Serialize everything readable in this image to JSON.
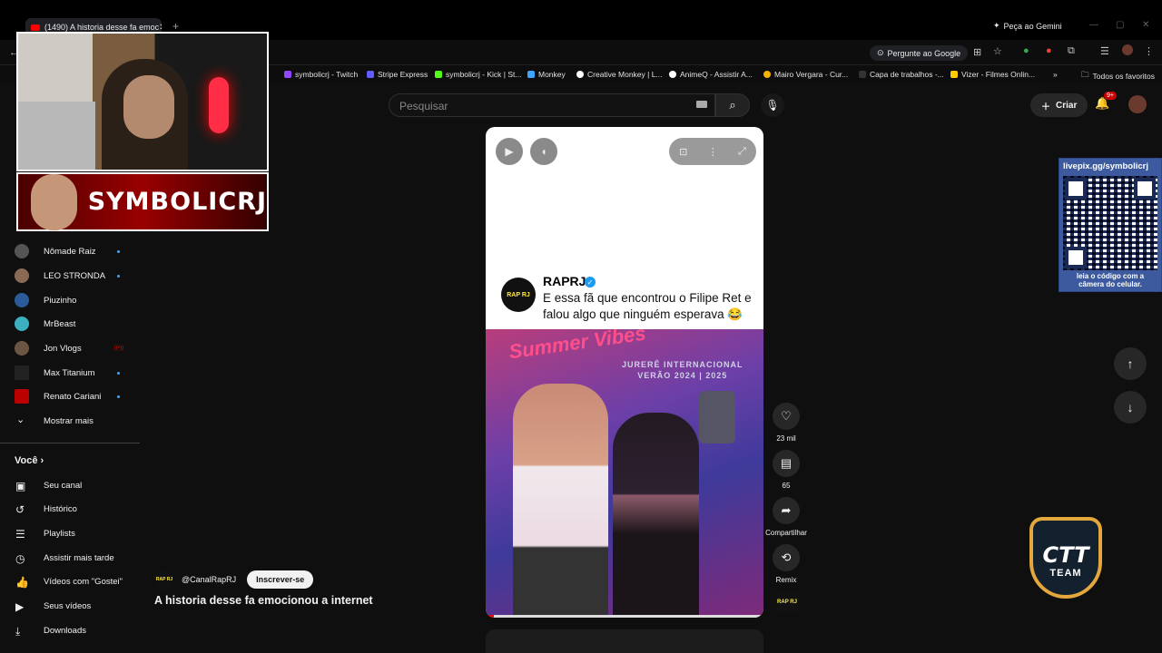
{
  "browser": {
    "tab_title": "(1490) A historia desse fa emoc",
    "new_tab": "+",
    "gemini": "Peça ao Gemini",
    "ask_google": "Pergunte ao Google"
  },
  "bookmarks": [
    {
      "label": "symbolicrj - Twitch",
      "color": "#9146ff"
    },
    {
      "label": "Stripe Express",
      "color": "#635bff"
    },
    {
      "label": "symbolicrj - Kick | St...",
      "color": "#53fc18"
    },
    {
      "label": "Monkey",
      "color": "#3ea6ff"
    },
    {
      "label": "Creative Monkey | L...",
      "color": "#ffffff"
    },
    {
      "label": "AnimeQ - Assistir A...",
      "color": "#ffffff"
    },
    {
      "label": "Mairo Vergara - Cur...",
      "color": "#f4b400"
    },
    {
      "label": "Capa de trabalhos -...",
      "color": "#333333"
    },
    {
      "label": "Vizer - Filmes Onlin...",
      "color": "#ffcc00"
    }
  ],
  "bookmarks_all": "Todos os favoritos",
  "masthead": {
    "search_placeholder": "Pesquisar",
    "create_label": "Criar",
    "notif_badge": "9+"
  },
  "overlay": {
    "streamer_name": "SYMBOLICRJ"
  },
  "sidebar": {
    "subscriptions": [
      {
        "name": "Nômade Raiz",
        "dot": true,
        "color": "#555"
      },
      {
        "name": "LEO STRONDA",
        "dot": true,
        "color": "#8a6a55"
      },
      {
        "name": "Piuzinho",
        "dot": false,
        "color": "#2a5a9a"
      },
      {
        "name": "MrBeast",
        "dot": false,
        "color": "#3ab0c0"
      },
      {
        "name": "Jon Vlogs",
        "dot": false,
        "live": true,
        "color": "#6b5545"
      },
      {
        "name": "Max Titanium",
        "dot": true,
        "color": "#222"
      },
      {
        "name": "Renato Cariani",
        "dot": true,
        "color": "#b00"
      }
    ],
    "show_more": "Mostrar mais",
    "you_label": "Você",
    "you_items": [
      {
        "label": "Seu canal",
        "icon": "channel-icon",
        "glyph": "▣"
      },
      {
        "label": "Histórico",
        "icon": "history-icon",
        "glyph": "↺"
      },
      {
        "label": "Playlists",
        "icon": "playlists-icon",
        "glyph": "☰"
      },
      {
        "label": "Assistir mais tarde",
        "icon": "clock-icon",
        "glyph": "◷"
      },
      {
        "label": "Vídeos com \"Gostei\"",
        "icon": "thumbs-up-icon",
        "glyph": "👍"
      },
      {
        "label": "Seus vídeos",
        "icon": "video-icon",
        "glyph": "▶"
      },
      {
        "label": "Downloads",
        "icon": "download-icon",
        "glyph": "⤓"
      }
    ]
  },
  "short": {
    "tweet_account": "RAPRJ",
    "tweet_logo": "RAP RJ",
    "tweet_text": "E essa fã que encontrou o Filipe Ret e falou algo que ninguém esperava 😂",
    "banner_text": "Summer Vibes",
    "banner_sub": "JURERÊ INTERNACIONAL\nVERÃO 2024 | 2025",
    "progress": 0.03,
    "likes": "23 mil",
    "comments": "65",
    "share": "Compartilhar",
    "remix": "Remix",
    "channel": "@CanalRapRJ",
    "subscribe": "Inscrever-se",
    "title": "A historia desse fa emocionou a internet"
  },
  "qr": {
    "url": "livepix.gg/symbolicrj",
    "caption": "leia o código com a câmera do celular."
  },
  "team_logo": {
    "text": "CTT",
    "sub": "TEAM"
  }
}
